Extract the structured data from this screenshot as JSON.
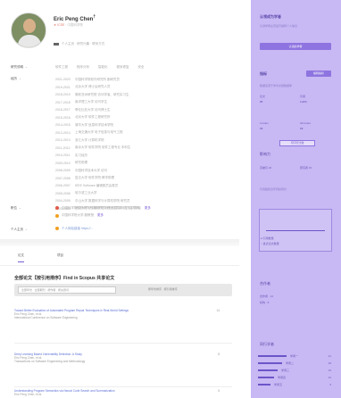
{
  "profile": {
    "name": "Eric Peng Chen",
    "superscript": "†",
    "affiliation_badge": "★ ICSE",
    "affiliation_extra": "· 中国科学院",
    "slogan": " 个人主页 · 研究兴趣 · 联系方式"
  },
  "rows": {
    "tags_label": "研究领域",
    "tags": [
      "软件工程",
      "程序分析",
      "智能化",
      "程序修复",
      "安全"
    ],
    "edu_label": "经历",
    "edu": [
      {
        "year": "2021-2023",
        "text": "中国科学院软件研究所 副研究员"
      },
      {
        "year": "2019-2021",
        "text": "北京大学 博士后研究人员"
      },
      {
        "year": "2018-2019",
        "text": "微软亚洲研究院 访问学者、研究实习生"
      },
      {
        "year": "2017-2018",
        "text": "南洋理工大学 访问学生"
      },
      {
        "year": "2016-2017",
        "text": "哥伦比亚大学 访问博士生"
      },
      {
        "year": "2015-2016",
        "text": "北京大学 软件工程研究所"
      },
      {
        "year": "2014-2015",
        "text": "清华大学 信息科学技术学院"
      },
      {
        "year": "2013-2014",
        "text": "上海交通大学 电子信息与电气工程"
      },
      {
        "year": "2012-2013",
        "text": "浙江大学 计算机学院"
      },
      {
        "year": "2011-2012",
        "text": "南京大学 软件学院 软件工程专业 本科生"
      },
      {
        "year": "2010-2011",
        "text": "实习经历"
      },
      {
        "year": "2009-2010",
        "text": "研究助理"
      },
      {
        "year": "2008-2009",
        "text": "中国科学技术大学 访问"
      },
      {
        "year": "2007-2008",
        "text": "复旦大学 软件学院 教学助理"
      },
      {
        "year": "2006-2007",
        "text": "IEEE Software 编辑委员会委员"
      },
      {
        "year": "2005-2006",
        "text": "哈尔滨工业大学"
      },
      {
        "year": "2004-2005",
        "text": "中山大学 数据科学与计算机学院 研究员"
      },
      {
        "year": "2003-2004",
        "text": "武汉大学 计算机学院 研究助理 实习生 访问学者",
        "more": "更多"
      }
    ],
    "job_label": "职位",
    "jobs": [
      {
        "color": "#e05a4a",
        "text": "中国科学院软件研究所 副研究员 博士生导师 研究生导师"
      },
      {
        "color": "#f0a020",
        "text": "中国科学院大学 副教授",
        "more": "更多"
      }
    ],
    "homepage_label": "个人主页",
    "homepage_link": "个人网站链接 https://..."
  },
  "tabs": {
    "papers": "论文",
    "projects": "项目"
  },
  "papers_section": {
    "title": "全部论文【按引用排序】Find in Scopus 共享论文",
    "filter_placeholder": "全部年份 · 全部期刊 · 按作者 · 按关键词",
    "sort_text": "按年份排序 · 按引用排序",
    "items": [
      {
        "title": "Toward Better Evaluation of Automated Program Repair Techniques in Real-World Settings",
        "authors": "Eric Peng Chen, et al.",
        "venue": "International Conference on Software Engineering",
        "cites": "14"
      },
      {
        "title": "Deep Learning Based Vulnerability Detection: A Study",
        "authors": "Eric Peng Chen, et al.",
        "venue": "Transactions on Software Engineering and Methodology",
        "cites": "8"
      },
      {
        "title": "Understanding Program Semantics via Neural Code Search and Summarization",
        "authors": "Eric Peng Chen, et al.",
        "venue": "",
        "cites": "5"
      }
    ]
  },
  "sidebar": {
    "claim_title": "认领成为学者",
    "claim_text": "认领学者主页后可编辑个人信息",
    "claim_button": "认领此学者",
    "metrics_title": "指标",
    "metrics_button": "编辑指标",
    "metrics_text": "数据来源于学术文献数据库",
    "stats": [
      {
        "label": "论文",
        "value": "25"
      },
      {
        "label": "引用",
        "value": "1,024"
      },
      {
        "label": "h-index",
        "value": "16"
      },
      {
        "label": "i10-index",
        "value": "19"
      }
    ],
    "compare_button": "与同行比较",
    "influence_title": "影响力",
    "influence_rows": [
      "高被引 20",
      "研究者 15"
    ],
    "chart_caption": "引用趋势近年持续增长",
    "legend": [
      "引用数量",
      "发表论文数量"
    ],
    "cowork_title": "合作者",
    "cowork_rows": [
      "合作者 · 12",
      "机构 · 8"
    ],
    "ranks_title": "同行学者",
    "ranks": [
      {
        "label": "学者一",
        "n": "21"
      },
      {
        "label": "学者二",
        "n": "18"
      },
      {
        "label": "学者三",
        "n": "15"
      },
      {
        "label": "学者四",
        "n": "12"
      },
      {
        "label": "学者五",
        "n": "9"
      }
    ],
    "rank_fill": [
      0.8,
      0.68,
      0.56,
      0.45,
      0.34
    ]
  }
}
